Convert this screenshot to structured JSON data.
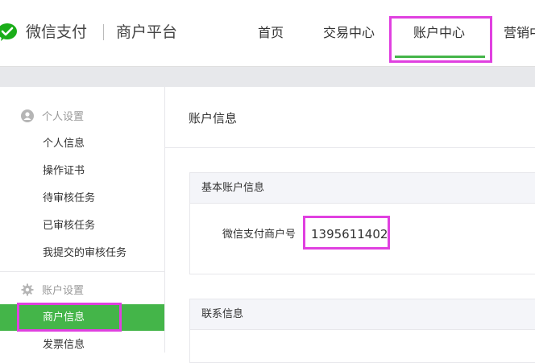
{
  "header": {
    "brand": "微信支付",
    "platform": "商户平台",
    "nav": [
      {
        "label": "首页"
      },
      {
        "label": "交易中心"
      },
      {
        "label": "账户中心"
      },
      {
        "label": "营销中"
      }
    ],
    "active_nav": "账户中心"
  },
  "sidebar": {
    "sections": [
      {
        "title": "个人设置",
        "icon": "user-icon",
        "items": [
          "个人信息",
          "操作证书",
          "待审核任务",
          "已审核任务",
          "我提交的审核任务"
        ]
      },
      {
        "title": "账户设置",
        "icon": "gear-icon",
        "items": [
          "商户信息",
          "发票信息"
        ]
      }
    ],
    "active_item": "商户信息"
  },
  "main": {
    "title": "账户信息",
    "basic_panel": {
      "title": "基本账户信息",
      "merchant_id_label": "微信支付商户号",
      "merchant_id_value": "1395611402"
    },
    "contact_panel": {
      "title": "联系信息"
    }
  },
  "colors": {
    "accent_green": "#44b549",
    "highlight_magenta": "#e040e0",
    "header_gray": "#e7e8eb"
  }
}
